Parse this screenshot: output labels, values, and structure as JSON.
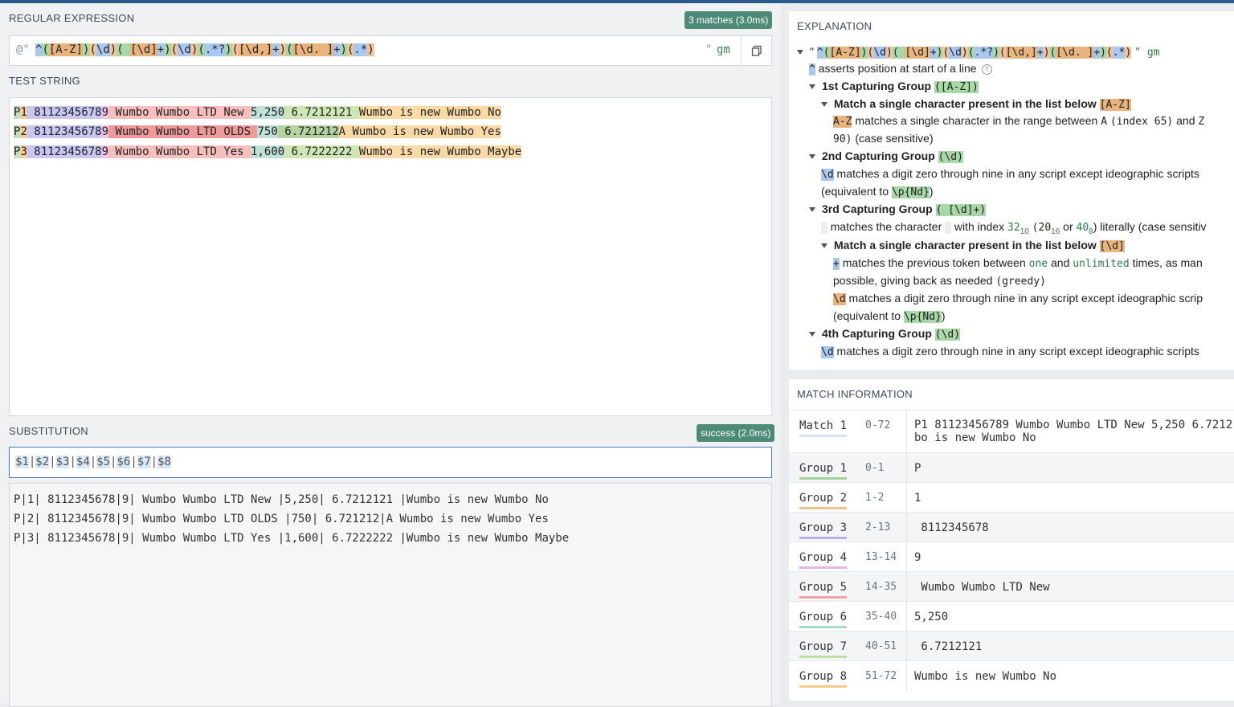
{
  "regex": {
    "label": "REGULAR EXPRESSION",
    "badge": "3 matches (3.0ms)",
    "prefix": "@\"",
    "suffix": "\"",
    "flags": "gm",
    "tokens": [
      "^",
      "(",
      "[A-Z]",
      ")",
      "(",
      "\\d",
      ")",
      "(",
      " ",
      "[\\d]",
      "+",
      ")",
      "(",
      "\\d",
      ")",
      "(",
      ".*?",
      ")",
      "(",
      "[\\d,]",
      "+",
      ")",
      "(",
      "[\\d. ]",
      "+",
      ")",
      "(",
      ".*",
      ")"
    ]
  },
  "test": {
    "label": "TEST STRING",
    "lines": [
      [
        "P",
        "1",
        " 8112345678",
        "9",
        " Wumbo Wumbo LTD New ",
        "5,250",
        " 6.7212121 ",
        "Wumbo is new Wumbo No"
      ],
      [
        "P",
        "2",
        " 8112345678",
        "9",
        " Wumbo Wumbo LTD OLDS ",
        "750",
        " 6.721212",
        "A Wumbo is new Wumbo Yes"
      ],
      [
        "P",
        "3",
        " 8112345678",
        "9",
        " Wumbo Wumbo LTD Yes ",
        "1,600",
        " 6.7222222 ",
        "Wumbo is new Wumbo Maybe"
      ]
    ]
  },
  "substitution": {
    "label": "SUBSTITUTION",
    "badge": "success (2.0ms)",
    "tokens": [
      "$1",
      "|",
      "$2",
      "|",
      "$3",
      "|",
      "$4",
      "|",
      "$5",
      "|",
      "$6",
      "|",
      "$7",
      "|",
      "$8"
    ],
    "results": [
      "P|1| 8112345678|9| Wumbo Wumbo LTD New |5,250| 6.7212121 |Wumbo is new Wumbo No",
      "P|2| 8112345678|9| Wumbo Wumbo LTD OLDS |750| 6.721212|A Wumbo is new Wumbo Yes",
      "P|3| 8112345678|9| Wumbo Wumbo LTD Yes |1,600| 6.7222222 |Wumbo is new Wumbo Maybe"
    ]
  },
  "explanation": {
    "title": "EXPLANATION",
    "root_open": "\"",
    "root_pattern_tokens": [
      "^",
      "(",
      "[A-Z]",
      ")",
      "(",
      "\\d",
      ")",
      "(",
      " ",
      "[\\d]",
      "+",
      ")",
      "(",
      "\\d",
      ")",
      "(",
      ".*?",
      ")",
      "(",
      "[\\d,]",
      "+",
      ")",
      "(",
      "[\\d. ]",
      "+",
      ")",
      "(",
      ".*",
      ")"
    ],
    "root_close": "\" gm",
    "anchor_token": "^",
    "anchor_text": "asserts position at start of a line",
    "help_symbol": "?",
    "g1_title": "1st Capturing Group",
    "g1_pattern": "([A-Z])",
    "g1_sub_title": "Match a single character present in the list below",
    "g1_sub_token": "[A-Z]",
    "g1_range_token": "A-Z",
    "g1_range_text": "matches a single character in the range between",
    "g1_a": "A",
    "g1_a_idx": "(index 65)",
    "g1_and": "and",
    "g1_z": "Z",
    "g1_z_idx": "90)",
    "g1_case": "(case sensitive)",
    "g2_title": "2nd Capturing Group",
    "g2_pattern": "(\\d)",
    "digit_token": "\\d",
    "digit_text": "matches a digit zero through nine in any script except ideographic scripts",
    "digit_text_cut": "matches a digit zero through nine in any script except ideographic scrip",
    "equiv_open": "(equivalent to",
    "equiv_token": "\\p{Nd}",
    "equiv_close": ")",
    "g3_title": "3rd Capturing Group",
    "g3_pattern": "( [\\d]+)",
    "space_text_1": "matches the character",
    "space_text_2": "with index",
    "idx_dec": "32",
    "idx_dec_base": "10",
    "idx_hex": "(20",
    "idx_hex_base": "16",
    "idx_or": "or",
    "idx_oct": "40",
    "idx_oct_base": "8",
    "idx_tail": ") literally (case sensitiv",
    "g3_sub_title": "Match a single character present in the list below",
    "g3_sub_token": "[\\d]",
    "plus_token": "+",
    "plus_text_1": "matches the previous token between",
    "plus_one": "one",
    "plus_and": "and",
    "plus_unlimited": "unlimited",
    "plus_text_2": "times, as man",
    "plus_text_3": "possible, giving back as needed",
    "plus_greedy": "(greedy)",
    "g4_title": "4th Capturing Group",
    "g4_pattern": "(\\d)"
  },
  "match_info": {
    "title": "MATCH INFORMATION",
    "rows": [
      {
        "name": "Match 1",
        "range": "0-72",
        "value": "P1 81123456789 Wumbo Wumbo LTD New 5,250 6.7212",
        "value2": "bo is new Wumbo No",
        "color": "#cfe6f7"
      },
      {
        "name": "Group 1",
        "range": "0-1",
        "value": "P",
        "color": "#9ed29e"
      },
      {
        "name": "Group 2",
        "range": "1-2",
        "value": "1",
        "color": "#f2c08a"
      },
      {
        "name": "Group 3",
        "range": "2-13",
        "value": " 8112345678",
        "color": "#b4afee"
      },
      {
        "name": "Group 4",
        "range": "13-14",
        "value": "9",
        "color": "#e9b3e5"
      },
      {
        "name": "Group 5",
        "range": "14-35",
        "value": " Wumbo Wumbo LTD New ",
        "color": "#f1a3a3"
      },
      {
        "name": "Group 6",
        "range": "35-40",
        "value": "5,250",
        "color": "#a7d8c9"
      },
      {
        "name": "Group 7",
        "range": "40-51",
        "value": " 6.7212121 ",
        "color": "#bde0a2"
      },
      {
        "name": "Group 8",
        "range": "51-72",
        "value": "Wumbo is new Wumbo No",
        "color": "#f6cc88"
      }
    ]
  },
  "colors": {
    "accent": "#2d5a8c",
    "badge": "#4d8a77",
    "group_highlights": [
      "#bfe1bf",
      "#f6ce9e",
      "#c9c6f3",
      "#efc7ec",
      "#f7bebe",
      "#bfe1d8",
      "#cde6b4",
      "#f9d9a5"
    ]
  },
  "icons": {
    "copy": "copy-icon",
    "collapse": "caret-down-icon",
    "help": "help-circle-icon"
  }
}
